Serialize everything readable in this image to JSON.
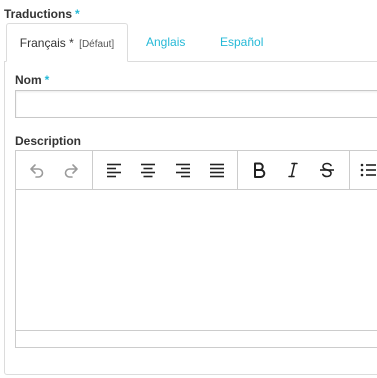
{
  "translations": {
    "label": "Traductions",
    "required_mark": "*"
  },
  "tabs": [
    {
      "label": "Français *",
      "note": "[Défaut]",
      "active": true
    },
    {
      "label": "Anglais",
      "active": false
    },
    {
      "label": "Español",
      "active": false
    }
  ],
  "name_field": {
    "label": "Nom",
    "required_mark": "*",
    "value": "",
    "placeholder": ""
  },
  "description": {
    "label": "Description",
    "content": ""
  },
  "toolbar": {
    "buttons": [
      {
        "icon": "undo-icon"
      },
      {
        "icon": "redo-icon"
      },
      {
        "icon": "align-left-icon"
      },
      {
        "icon": "align-center-icon"
      },
      {
        "icon": "align-right-icon"
      },
      {
        "icon": "align-justify-icon"
      },
      {
        "icon": "bold-icon"
      },
      {
        "icon": "italic-icon"
      },
      {
        "icon": "strikethrough-icon"
      },
      {
        "icon": "bullet-list-icon"
      }
    ]
  },
  "colors": {
    "accent": "#25b9d7",
    "text": "#333333",
    "border": "#dcdcdc",
    "icon": "#222222",
    "icon_disabled": "#9a9a9a"
  }
}
